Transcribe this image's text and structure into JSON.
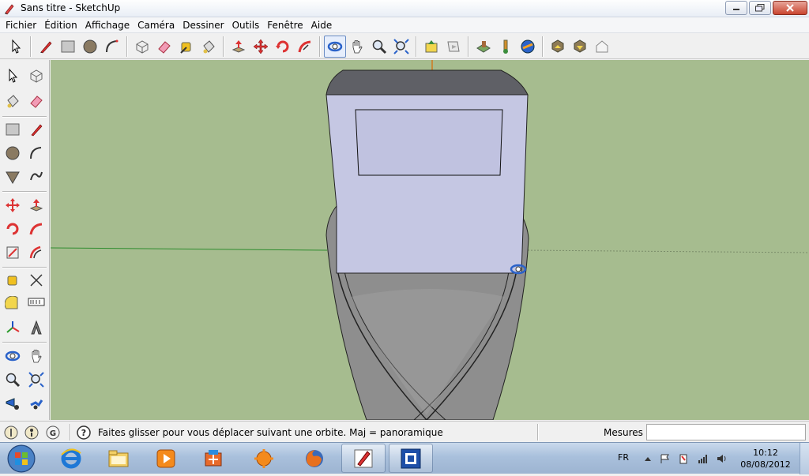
{
  "window": {
    "title": "Sans titre - SketchUp"
  },
  "menu": [
    "Fichier",
    "Édition",
    "Affichage",
    "Caméra",
    "Dessiner",
    "Outils",
    "Fenêtre",
    "Aide"
  ],
  "toolbar_top": [
    "select-tool-icon",
    "line-tool-icon",
    "rectangle-tool-icon",
    "circle-tool-icon",
    "arc-tool-icon",
    "make-component-icon",
    "eraser-icon",
    "tape-measure-icon",
    "paint-bucket-icon",
    "push-pull-icon",
    "move-icon",
    "rotate-icon",
    "follow-me-icon",
    "orbit-icon",
    "pan-icon",
    "zoom-icon",
    "zoom-extents-icon",
    "get-models-icon",
    "share-model-icon",
    "upload-icon",
    "get-photo-texture-icon",
    "place-model-icon",
    "preview-icon",
    "share-component-icon",
    "get-components-icon",
    "3d-warehouse-icon"
  ],
  "status": {
    "message": "Faites glisser pour vous déplacer suivant une orbite.  Maj = panoramique",
    "measure_label": "Mesures",
    "measure_value": ""
  },
  "taskbar": {
    "lang": "FR",
    "time": "10:12",
    "date": "08/08/2012",
    "apps": [
      "internet-explorer-icon",
      "file-explorer-icon",
      "media-player-icon",
      "control-panel-icon",
      "avast-icon",
      "firefox-icon",
      "sketchup-icon",
      "app-window-icon"
    ]
  },
  "colors": {
    "sky_ground": "#a6bc8f",
    "box_face": "#c3c5e2",
    "hull": "#8e8e8e"
  }
}
